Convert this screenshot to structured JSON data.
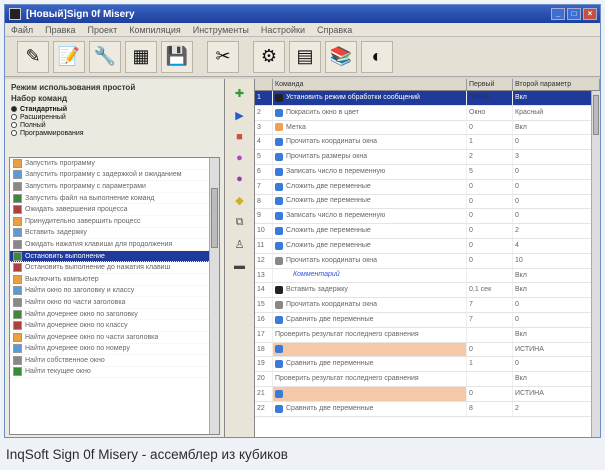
{
  "window": {
    "title": "[Новый]Sign 0f Misery",
    "controls": [
      "_",
      "□",
      "×"
    ]
  },
  "menu": [
    "Файл",
    "Правка",
    "Проект",
    "Компиляция",
    "Инструменты",
    "Настройки",
    "Справка"
  ],
  "toolbar": {
    "buttons": [
      {
        "icon": "pen-icon",
        "glyph": "✎"
      },
      {
        "icon": "note-icon",
        "glyph": "📝"
      },
      {
        "icon": "tools-icon",
        "glyph": "🔧"
      },
      {
        "icon": "blocks-icon",
        "glyph": "▦"
      },
      {
        "icon": "disk-icon",
        "glyph": "💾"
      },
      {
        "icon": "cut-icon",
        "glyph": "✂"
      },
      {
        "icon": "gear-icon",
        "glyph": "⚙"
      },
      {
        "icon": "chart-icon",
        "glyph": "▤"
      },
      {
        "icon": "books-icon",
        "glyph": "📚"
      },
      {
        "icon": "help-icon",
        "glyph": "◐"
      }
    ]
  },
  "mode_panel": {
    "title": "Режим использования простой",
    "set_label": "Набор команд",
    "options": [
      {
        "label": "Стандартный",
        "selected": true
      },
      {
        "label": "Расширенный",
        "selected": false
      },
      {
        "label": "Полный",
        "selected": false
      },
      {
        "label": "Программирования",
        "selected": false
      }
    ]
  },
  "commands": [
    "Запустить программу",
    "Запустить программу с задержкой и ожиданием",
    "Запустить программу с параметрами",
    "Запустить файл на выполнение команд",
    "Ожидать завершения процесса",
    "Принудительно завершить процесс",
    "Вставить задержку",
    "Ожидать нажатия клавиши для продолжения",
    "Остановить выполнение",
    "Остановить выполнение до нажатия клавиш",
    "Выключить компьютер",
    "Найти окно по заголовку и классу",
    "Найти окно по части заголовка",
    "Найти дочернее окно по заголовку",
    "Найти дочернее окно по классу",
    "Найти дочернее окно по части заголовка",
    "Найти дочернее окно по номеру",
    "Найти собственное окно",
    "Найти текущее окно"
  ],
  "selected_command_index": 8,
  "grid": {
    "headers": [
      "",
      "Команда",
      "Первый парам.",
      "Второй параметр"
    ],
    "rows": [
      {
        "n": "1",
        "cmd": "Установить режим обработки сообщений",
        "p1": "",
        "p2": "Вкл",
        "icon": "dark",
        "style": "sel"
      },
      {
        "n": "2",
        "cmd": "Покрасить окно в цвет",
        "p1": "Окно",
        "p2": "Красный",
        "icon": "blue",
        "style": ""
      },
      {
        "n": "3",
        "cmd": "Метка",
        "p1": "0",
        "p2": "Вкл",
        "icon": "orange",
        "style": ""
      },
      {
        "n": "4",
        "cmd": "Прочитать координаты окна",
        "p1": "1",
        "p2": "0",
        "icon": "blue",
        "style": ""
      },
      {
        "n": "5",
        "cmd": "Прочитать размеры окна",
        "p1": "2",
        "p2": "3",
        "icon": "blue",
        "style": ""
      },
      {
        "n": "6",
        "cmd": "Записать число в переменную",
        "p1": "5",
        "p2": "0",
        "icon": "blue",
        "style": ""
      },
      {
        "n": "7",
        "cmd": "Сложить две переменные",
        "p1": "0",
        "p2": "0",
        "icon": "blue",
        "style": ""
      },
      {
        "n": "8",
        "cmd": "Сложить две переменные",
        "p1": "0",
        "p2": "0",
        "icon": "blue",
        "style": ""
      },
      {
        "n": "9",
        "cmd": "Записать число в переменную",
        "p1": "0",
        "p2": "0",
        "icon": "blue",
        "style": ""
      },
      {
        "n": "10",
        "cmd": "Сложить две переменные",
        "p1": "0",
        "p2": "2",
        "icon": "blue",
        "style": ""
      },
      {
        "n": "11",
        "cmd": "Сложить две переменные",
        "p1": "0",
        "p2": "4",
        "icon": "blue",
        "style": ""
      },
      {
        "n": "12",
        "cmd": "Прочитать координаты окна",
        "p1": "0",
        "p2": "10",
        "icon": "gray",
        "style": ""
      },
      {
        "n": "13",
        "cmd": "Комментарий",
        "p1": "",
        "p2": "Вкл",
        "icon": "",
        "style": "comment"
      },
      {
        "n": "14",
        "cmd": "Вставить задержку",
        "p1": "0,1 сек",
        "p2": "Вкл",
        "icon": "dark",
        "style": ""
      },
      {
        "n": "15",
        "cmd": "Прочитать координаты окна",
        "p1": "7",
        "p2": "0",
        "icon": "gray",
        "style": ""
      },
      {
        "n": "16",
        "cmd": "Сравнить две переменные",
        "p1": "7",
        "p2": "0",
        "icon": "blue",
        "style": ""
      },
      {
        "n": "17",
        "cmd": "Проверить результат последнего сравнения",
        "p1": "",
        "p2": "Вкл",
        "icon": "",
        "style": ""
      },
      {
        "n": "18",
        "cmd": "",
        "p1": "0",
        "p2": "ИСТИНА",
        "icon": "blue",
        "style": "orange"
      },
      {
        "n": "19",
        "cmd": "Сравнить две переменные",
        "p1": "1",
        "p2": "0",
        "icon": "blue",
        "style": ""
      },
      {
        "n": "20",
        "cmd": "Проверить результат последнего сравнения",
        "p1": "",
        "p2": "Вкл",
        "icon": "",
        "style": ""
      },
      {
        "n": "21",
        "cmd": "",
        "p1": "0",
        "p2": "ИСТИНА",
        "icon": "blue",
        "style": "orange"
      },
      {
        "n": "22",
        "cmd": "Сравнить две переменные",
        "p1": "8",
        "p2": "2",
        "icon": "blue",
        "style": ""
      }
    ]
  },
  "midbar_icons": [
    {
      "name": "add-icon",
      "glyph": "✚",
      "color": "#2e9a2e"
    },
    {
      "name": "arrow-right-icon",
      "glyph": "▶",
      "color": "#2a5bd0"
    },
    {
      "name": "delete-icon",
      "glyph": "■",
      "color": "#d05040"
    },
    {
      "name": "purple-icon",
      "glyph": "●",
      "color": "#b048c0"
    },
    {
      "name": "purple2-icon",
      "glyph": "●",
      "color": "#9040b0"
    },
    {
      "name": "yellow-icon",
      "glyph": "◆",
      "color": "#d0b020"
    },
    {
      "name": "copy-icon",
      "glyph": "⧉",
      "color": "#555"
    },
    {
      "name": "person-icon",
      "glyph": "♙",
      "color": "#555"
    },
    {
      "name": "box-icon",
      "glyph": "▬",
      "color": "#444"
    }
  ],
  "caption": "InqSoft Sign 0f Misery - ассемблер из кубиков"
}
